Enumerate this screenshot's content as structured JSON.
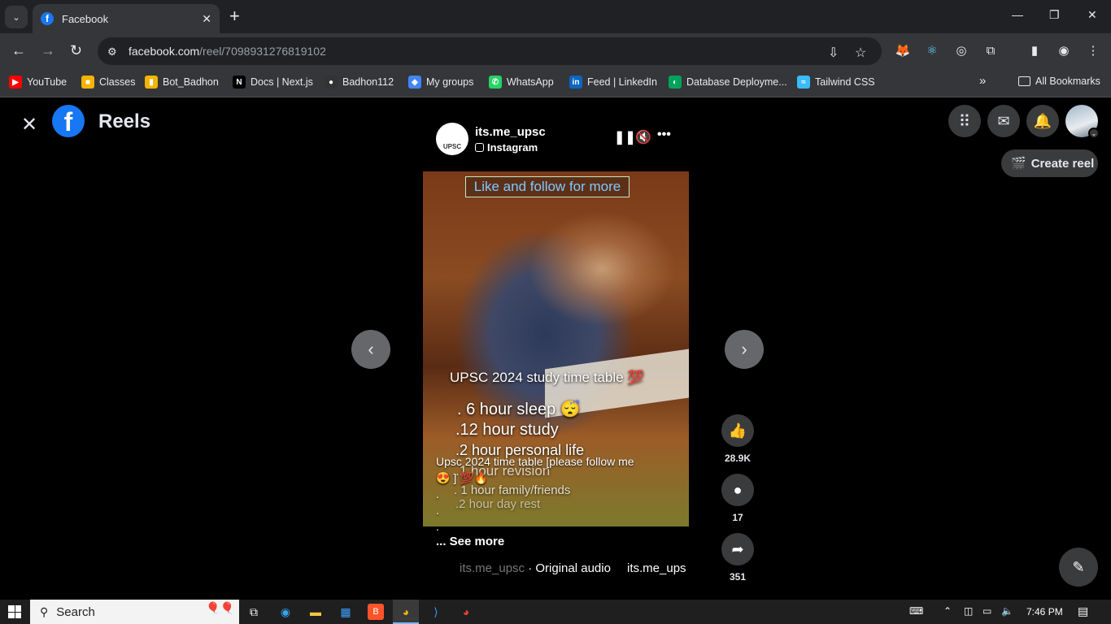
{
  "browser": {
    "tab_title": "Facebook",
    "url_host": "facebook.com",
    "url_path": "/reel/7098931276819102"
  },
  "bookmarks": [
    {
      "label": "YouTube",
      "color": "#ff0000",
      "glyph": "▶"
    },
    {
      "label": "Classes",
      "color": "#f4b400",
      "glyph": "■"
    },
    {
      "label": "Bot_Badhon",
      "color": "#f4b400",
      "glyph": "▮"
    },
    {
      "label": "Docs | Next.js",
      "color": "#000000",
      "glyph": "N"
    },
    {
      "label": "Badhon112",
      "color": "#333333",
      "glyph": "●"
    },
    {
      "label": "My groups",
      "color": "#4285f4",
      "glyph": "◆"
    },
    {
      "label": "WhatsApp",
      "color": "#25d366",
      "glyph": "✆"
    },
    {
      "label": "Feed | LinkedIn",
      "color": "#0a66c2",
      "glyph": "in"
    },
    {
      "label": "Database Deployme...",
      "color": "#00a35c",
      "glyph": "◐"
    },
    {
      "label": "Tailwind CSS",
      "color": "#38bdf8",
      "glyph": "≈"
    }
  ],
  "bookmarks_more": "»",
  "all_bookmarks": "All Bookmarks",
  "page": {
    "title": "Reels",
    "create_reel": "Create reel"
  },
  "reel": {
    "username": "its.me_upsc",
    "source": "Instagram",
    "avatar_text": "UPSC",
    "overlay_top": "Like and follow for more",
    "overlay_heading": "UPSC 2024 study time table 💯",
    "overlay_lines": [
      ". 6 hour sleep 😴",
      ".12 hour study",
      ".2 hour personal life",
      ".1 hour revision",
      ". 1 hour family/friends",
      ".2 hour day rest"
    ],
    "caption_lines": [
      "Upsc 2024 time table [please follow me",
      "😍 ] 💯🔥",
      ".",
      ".",
      "."
    ],
    "see_more": "... See more",
    "audio_faded": "its.me_upsc",
    "audio_label": " · Original audio",
    "audio_next": "its.me_ups"
  },
  "actions": {
    "likes": "28.9K",
    "comments": "17",
    "shares": "351"
  },
  "taskbar": {
    "search_placeholder": "Search",
    "time": "7:46 PM"
  }
}
